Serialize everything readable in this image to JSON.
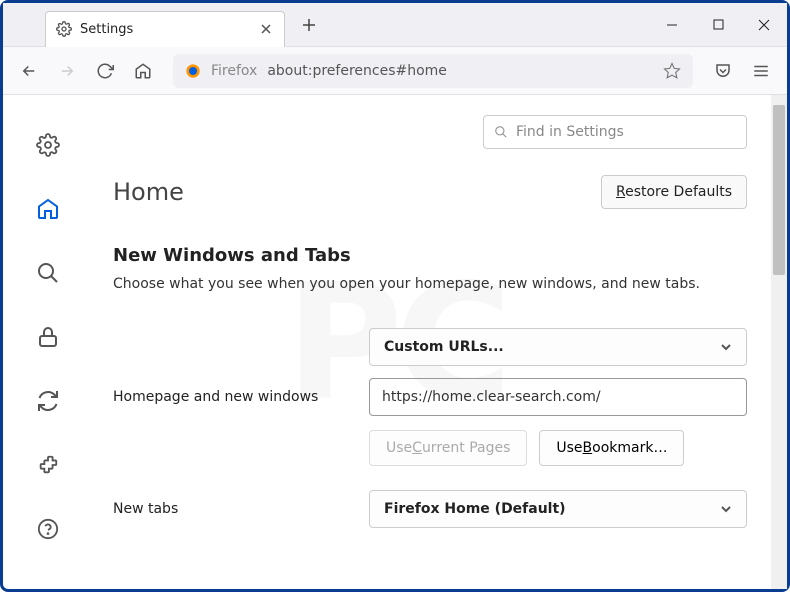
{
  "window": {
    "tab_title": "Settings"
  },
  "urlbar": {
    "firefox_label": "Firefox",
    "url": "about:preferences#home"
  },
  "search": {
    "placeholder": "Find in Settings"
  },
  "header": {
    "title": "Home",
    "restore_prefix": "R",
    "restore_rest": "estore Defaults"
  },
  "section": {
    "heading": "New Windows and Tabs",
    "description": "Choose what you see when you open your homepage, new windows, and new tabs."
  },
  "homepage": {
    "label": "Homepage and new windows",
    "dropdown_value": "Custom URLs...",
    "url_value": "https://home.clear-search.com/",
    "use_current_prefix": "Use ",
    "use_current_ul": "C",
    "use_current_rest": "urrent Pages",
    "use_bookmark_prefix": "Use ",
    "use_bookmark_ul": "B",
    "use_bookmark_rest": "ookmark…"
  },
  "newtabs": {
    "label": "New tabs",
    "dropdown_value": "Firefox Home (Default)"
  }
}
